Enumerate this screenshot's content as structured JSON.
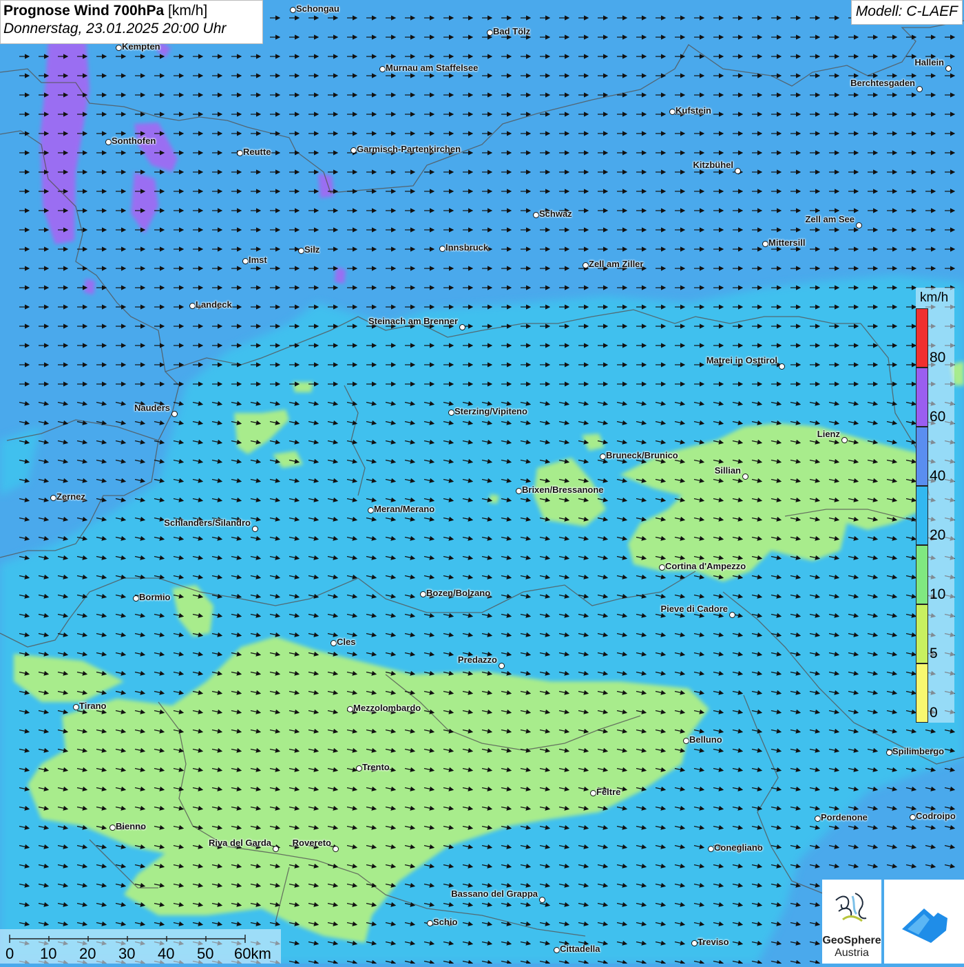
{
  "header": {
    "title_bold": "Prognose Wind 700hPa",
    "title_unit": "[km/h]",
    "datetime": "Donnerstag, 23.01.2025 20:00 Uhr",
    "model": "Modell: C-LAEF"
  },
  "legend": {
    "unit": "km/h",
    "ticks": [
      "80",
      "60",
      "40",
      "20",
      "10",
      "5",
      "0"
    ],
    "colors": [
      "#f03030",
      "#9a5ef0",
      "#5a8ef0",
      "#32b8f0",
      "#80e880",
      "#c8f060",
      "#f8f870"
    ]
  },
  "scalebar": {
    "labels": [
      "0",
      "10",
      "20",
      "30",
      "40",
      "50",
      "60km"
    ]
  },
  "brand": {
    "name_line1": "GeoSphere",
    "name_line2": "Austria"
  },
  "wind": {
    "direction": "east",
    "description_colors": {
      "purple": "#9a6ef2",
      "blue": "#4aa9ec",
      "cyan": "#3fc0ee",
      "green": "#a8ec8c"
    }
  },
  "cities": [
    {
      "name": "Schongau"
    },
    {
      "name": "Bad Tölz"
    },
    {
      "name": "Kempten"
    },
    {
      "name": "Murnau am Staffelsee"
    },
    {
      "name": "Hallein"
    },
    {
      "name": "Berchtesgaden"
    },
    {
      "name": "Kufstein"
    },
    {
      "name": "Sonthofen"
    },
    {
      "name": "Reutte"
    },
    {
      "name": "Garmisch-Partenkirchen"
    },
    {
      "name": "Kitzbühel"
    },
    {
      "name": "Schwaz"
    },
    {
      "name": "Zell am See"
    },
    {
      "name": "Innsbruck"
    },
    {
      "name": "Mittersill"
    },
    {
      "name": "Silz"
    },
    {
      "name": "Imst"
    },
    {
      "name": "Zell am Ziller"
    },
    {
      "name": "Landeck"
    },
    {
      "name": "Steinach am Brenner"
    },
    {
      "name": "Matrei in Osttirol"
    },
    {
      "name": "Nauders"
    },
    {
      "name": "Sterzing/Vipiteno"
    },
    {
      "name": "Lienz"
    },
    {
      "name": "Bruneck/Brunico"
    },
    {
      "name": "Sillian"
    },
    {
      "name": "Brixen/Bressanone"
    },
    {
      "name": "Zernez"
    },
    {
      "name": "Meran/Merano"
    },
    {
      "name": "Schlanders/Silandro"
    },
    {
      "name": "Cortina d'Ampezzo"
    },
    {
      "name": "Bozen/Bolzano"
    },
    {
      "name": "Bormio"
    },
    {
      "name": "Pieve di Cadore"
    },
    {
      "name": "Cles"
    },
    {
      "name": "Predazzo"
    },
    {
      "name": "Tirano"
    },
    {
      "name": "Mezzolombardo"
    },
    {
      "name": "Belluno"
    },
    {
      "name": "Spilimbergo"
    },
    {
      "name": "Trento"
    },
    {
      "name": "Feltre"
    },
    {
      "name": "Pordenone"
    },
    {
      "name": "Codroipo"
    },
    {
      "name": "Bienno"
    },
    {
      "name": "Riva del Garda"
    },
    {
      "name": "Rovereto"
    },
    {
      "name": "Conegliano"
    },
    {
      "name": "Bassano del Grappa"
    },
    {
      "name": "Schio"
    },
    {
      "name": "Treviso"
    },
    {
      "name": "Cittadella"
    }
  ]
}
